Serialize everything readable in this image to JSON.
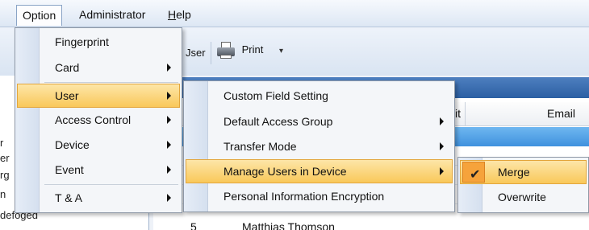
{
  "menubar": {
    "items": [
      {
        "label": "Option",
        "mnemonic": "",
        "rest": ""
      },
      {
        "label": "Administrator",
        "mnemonic": "",
        "rest": ""
      },
      {
        "label": "",
        "mnemonic": "H",
        "rest": "elp"
      }
    ]
  },
  "toolbar": {
    "user_label": "Jser",
    "print_label": "Print"
  },
  "background": {
    "left_fragments": [
      "r",
      "er",
      "rg",
      "n",
      "defoged"
    ],
    "grid_header": [
      "it",
      "Email"
    ],
    "last_row": {
      "num": "5",
      "name": "Matthias Thomson"
    }
  },
  "option_menu": {
    "items": [
      {
        "label": "Fingerprint",
        "submenu": false
      },
      {
        "label": "Card",
        "submenu": true
      },
      {
        "label": "User",
        "submenu": true
      },
      {
        "label": "Access Control",
        "submenu": true
      },
      {
        "label": "Device",
        "submenu": true
      },
      {
        "label": "Event",
        "submenu": true
      },
      {
        "label": "T & A",
        "submenu": true
      }
    ]
  },
  "user_menu": {
    "items": [
      {
        "label": "Custom Field Setting",
        "submenu": false
      },
      {
        "label": "Default Access Group",
        "submenu": true
      },
      {
        "label": "Transfer Mode",
        "submenu": true
      },
      {
        "label": "Manage Users in Device",
        "submenu": true
      },
      {
        "label": "Personal Information Encryption",
        "submenu": false
      }
    ]
  },
  "manage_menu": {
    "items": [
      {
        "label": "Merge",
        "checked": true
      },
      {
        "label": "Overwrite",
        "checked": false
      }
    ]
  },
  "colors": {
    "highlight": "#f9c85a",
    "check": "#f6a33b",
    "selected_row": "#3f91de"
  }
}
